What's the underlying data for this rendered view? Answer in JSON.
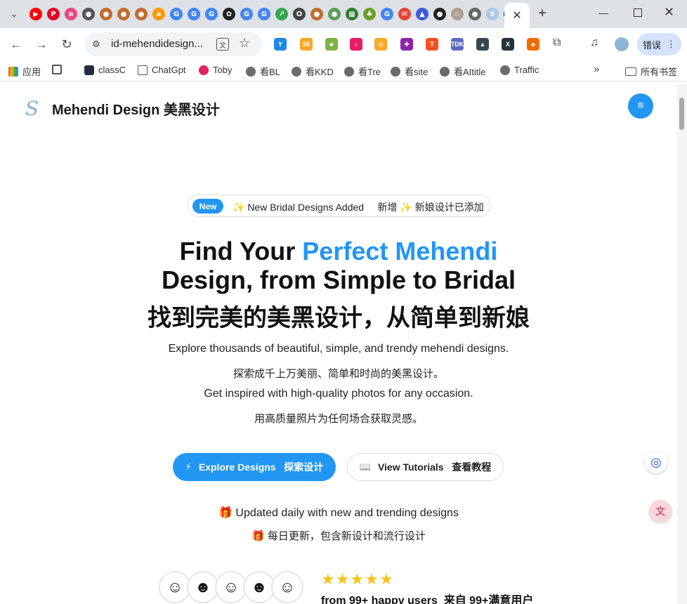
{
  "browser": {
    "active_tab_close": "✕",
    "new_tab": "+",
    "tab_favicons": [
      {
        "letter": "▶",
        "color": "#ff0000"
      },
      {
        "letter": "P",
        "color": "#e60023"
      },
      {
        "letter": "ʚ",
        "color": "#e6497f"
      },
      {
        "letter": "●",
        "color": "#555555"
      },
      {
        "letter": "●",
        "color": "#c46b2e"
      },
      {
        "letter": "●",
        "color": "#c46b2e"
      },
      {
        "letter": "●",
        "color": "#c46b2e"
      },
      {
        "letter": "a",
        "color": "#ff9900"
      },
      {
        "letter": "G",
        "color": "#4285f4"
      },
      {
        "letter": "G",
        "color": "#4285f4"
      },
      {
        "letter": "G",
        "color": "#4285f4"
      },
      {
        "letter": "✿",
        "color": "#222222"
      },
      {
        "letter": "G",
        "color": "#4285f4"
      },
      {
        "letter": "G",
        "color": "#4285f4"
      },
      {
        "letter": "↗",
        "color": "#34a853"
      },
      {
        "letter": "O",
        "color": "#444444"
      },
      {
        "letter": "●",
        "color": "#c46b2e"
      },
      {
        "letter": "●",
        "color": "#5a9e5a"
      },
      {
        "letter": "▦",
        "color": "#2e7d32"
      },
      {
        "letter": "♣",
        "color": "#6a9f2a"
      },
      {
        "letter": "G",
        "color": "#4285f4"
      },
      {
        "letter": "✉",
        "color": "#ea4335"
      },
      {
        "letter": "▲",
        "color": "#3b5bdb"
      },
      {
        "letter": "●",
        "color": "#222222"
      },
      {
        "letter": "♨",
        "color": "#b0a090"
      },
      {
        "letter": "●",
        "color": "#666666"
      },
      {
        "letter": "S",
        "color": "#aac8e8"
      },
      {
        "letter": "▲",
        "color": "#111111"
      }
    ],
    "url": "id-mehendidesign...",
    "profile_label": "错误",
    "extensions": [
      {
        "label": "Y",
        "color": "#1e88e5"
      },
      {
        "label": "58",
        "color": "#f5a623"
      },
      {
        "label": "♣",
        "color": "#7cb342"
      },
      {
        "label": "♪",
        "color": "#e91e63"
      },
      {
        "label": "◎",
        "color": "#f9a825"
      },
      {
        "label": "✚",
        "color": "#8e24aa"
      },
      {
        "label": "T",
        "color": "#f4511e"
      },
      {
        "label": "TDK",
        "color": "#5c6bc0"
      },
      {
        "label": "▲",
        "color": "#37474f"
      },
      {
        "label": "X",
        "color": "#263238"
      },
      {
        "label": "◈",
        "color": "#ef6c00"
      },
      {
        "label": "⧉",
        "color": "#555555"
      }
    ],
    "bookmarks": [
      {
        "label": "应用",
        "icon": "apps-icon"
      },
      {
        "label": "",
        "icon": "grid-icon"
      },
      {
        "label": "classC",
        "icon": "class-icon"
      },
      {
        "label": "ChatGpt",
        "icon": "folder-icon"
      },
      {
        "label": "Toby",
        "icon": "toby-icon"
      },
      {
        "label": "看BL",
        "icon": "globe-icon"
      },
      {
        "label": "看KKD",
        "icon": "globe-icon"
      },
      {
        "label": "看Tre",
        "icon": "globe-icon"
      },
      {
        "label": "看site",
        "icon": "globe-icon"
      },
      {
        "label": "看AItitle",
        "icon": "globe-icon"
      },
      {
        "label": "Traffic",
        "icon": "globe-icon"
      }
    ],
    "bookmarks_more": "»",
    "all_bookmarks": "所有书签"
  },
  "header": {
    "logo_glyph": "S",
    "brand": "Mehendi Design  美黑设计",
    "menu_glyph": "≡"
  },
  "announce": {
    "badge": "New",
    "text": "✨ New Bridal Designs Added     新增 ✨ 新娘设计已添加"
  },
  "hero": {
    "line1_plain": "Find Your ",
    "line1_accent": "Perfect Mehendi",
    "line2": "Design, from Simple to Bridal",
    "line3": "找到完美的美黑设计，从简单到新娘",
    "sub1": "Explore thousands of beautiful, simple, and trendy mehendi designs.",
    "sub2": "探索成千上万美丽、简单和时尚的美黑设计。",
    "sub3": "Get inspired with high-quality photos for any occasion.",
    "sub4": "用高质量照片为任何场合获取灵感。"
  },
  "cta": {
    "explore_icon": "⚡",
    "explore_label": "Explore Designs   探索设计",
    "tutorial_icon": "📖",
    "tutorial_label": "View Tutorials   查看教程"
  },
  "updates": {
    "line1": "🎁 Updated daily with new and trending designs",
    "line2": "🎁 每日更新，包含新设计和流行设计"
  },
  "social": {
    "stars": "★★★★★",
    "rating": 5,
    "users_text": "from 99+ happy users  来自 99+满意用户"
  },
  "colors": {
    "accent": "#2196f3",
    "star": "#f5c518"
  }
}
